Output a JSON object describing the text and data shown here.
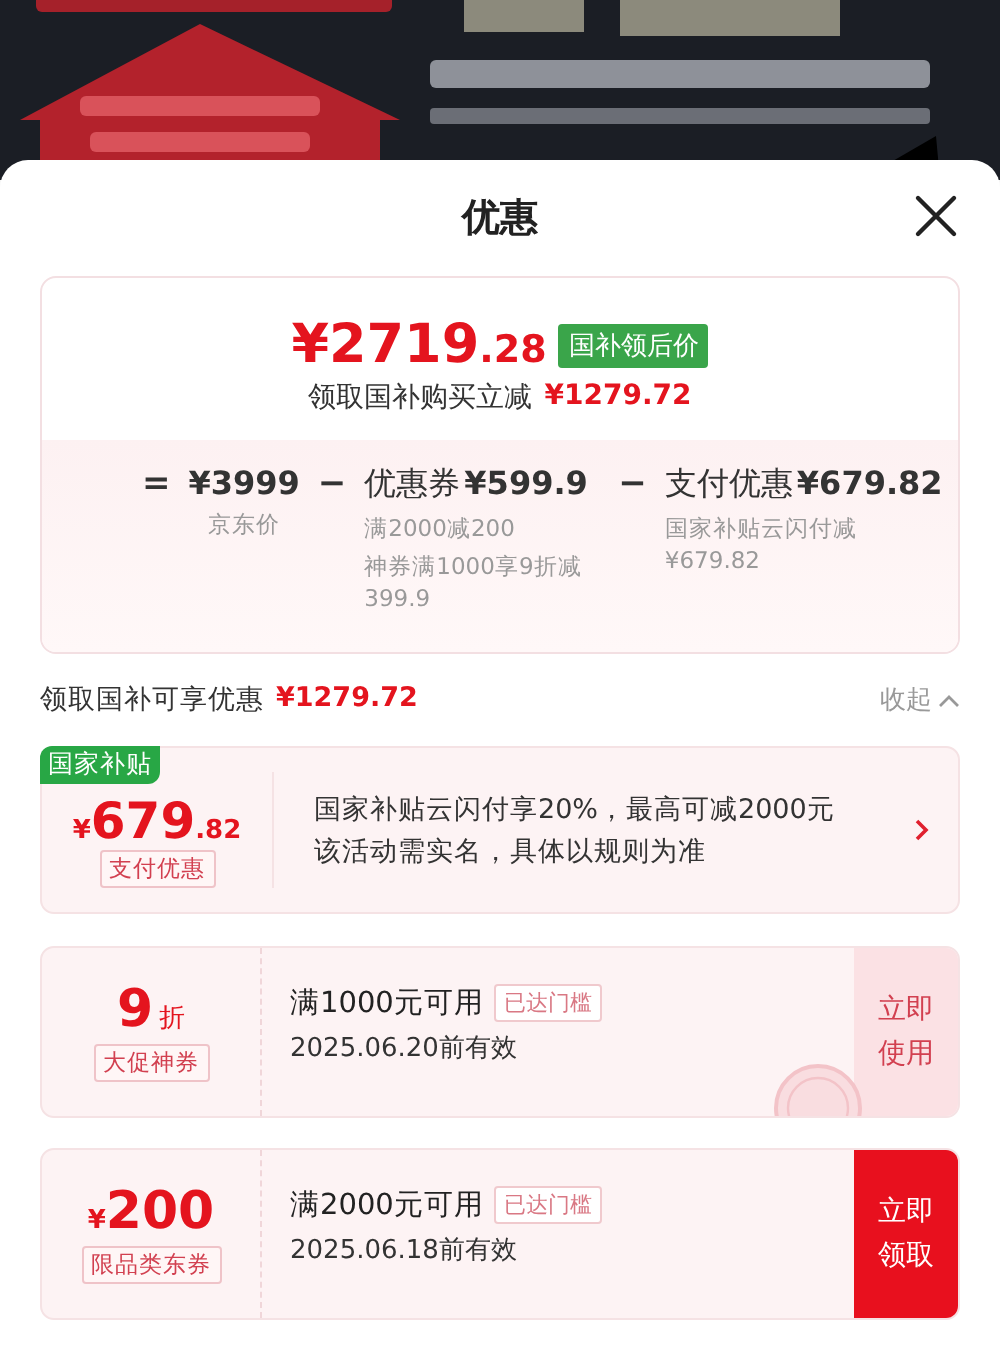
{
  "sheet": {
    "title": "优惠"
  },
  "summary": {
    "price_main": "¥2719",
    "price_decimal": ".28",
    "price_tag": "国补领后价",
    "saving_label": "领取国补购买立减",
    "saving_amount": "¥1279.72",
    "breakdown": [
      {
        "operator": "=",
        "amount": "¥3999",
        "notes": [
          "京东价"
        ]
      },
      {
        "operator": "−",
        "label": "优惠券",
        "amount": "¥599.9",
        "notes": [
          "满2000减200",
          "神券满1000享9折减399.9"
        ]
      },
      {
        "operator": "−",
        "label": "支付优惠",
        "amount": "¥679.82",
        "notes": [
          "国家补贴云闪付减¥679.82"
        ]
      }
    ]
  },
  "section": {
    "label": "领取国补可享优惠",
    "amount": "¥1279.72",
    "toggle": "收起"
  },
  "subsidy": {
    "badge": "国家补贴",
    "currency": "¥",
    "amount_main": "679",
    "amount_decimal": ".82",
    "tag": "支付优惠",
    "lines": [
      "国家补贴云闪付享20%，最高可减2000元",
      "该活动需实名，具体以规则为准"
    ]
  },
  "coupons": [
    {
      "value": "9",
      "unit": "折",
      "tag": "大促神券",
      "condition": "满1000元可用",
      "threshold": "已达门槛",
      "validity": "2025.06.20前有效",
      "action": "立即使用",
      "claimed": true
    },
    {
      "currency": "¥",
      "value": "200",
      "tag": "限品类东券",
      "condition": "满2000元可用",
      "threshold": "已达门槛",
      "validity": "2025.06.18前有效",
      "action": "立即领取",
      "claimed": false
    }
  ]
}
